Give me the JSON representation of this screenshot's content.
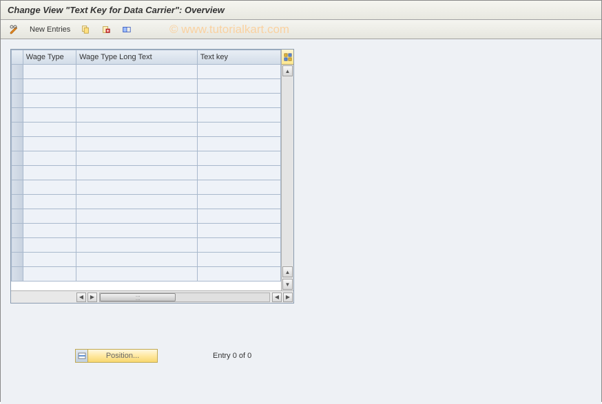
{
  "title": "Change View \"Text Key for Data Carrier\": Overview",
  "toolbar": {
    "new_entries_label": "New Entries"
  },
  "watermark": "© www.tutorialkart.com",
  "table": {
    "columns": {
      "wage_type": "Wage Type",
      "wage_type_long": "Wage Type Long Text",
      "text_key": "Text key"
    },
    "rows": [
      {
        "wage_type": "",
        "wage_type_long": "",
        "text_key": ""
      },
      {
        "wage_type": "",
        "wage_type_long": "",
        "text_key": ""
      },
      {
        "wage_type": "",
        "wage_type_long": "",
        "text_key": ""
      },
      {
        "wage_type": "",
        "wage_type_long": "",
        "text_key": ""
      },
      {
        "wage_type": "",
        "wage_type_long": "",
        "text_key": ""
      },
      {
        "wage_type": "",
        "wage_type_long": "",
        "text_key": ""
      },
      {
        "wage_type": "",
        "wage_type_long": "",
        "text_key": ""
      },
      {
        "wage_type": "",
        "wage_type_long": "",
        "text_key": ""
      },
      {
        "wage_type": "",
        "wage_type_long": "",
        "text_key": ""
      },
      {
        "wage_type": "",
        "wage_type_long": "",
        "text_key": ""
      },
      {
        "wage_type": "",
        "wage_type_long": "",
        "text_key": ""
      },
      {
        "wage_type": "",
        "wage_type_long": "",
        "text_key": ""
      },
      {
        "wage_type": "",
        "wage_type_long": "",
        "text_key": ""
      },
      {
        "wage_type": "",
        "wage_type_long": "",
        "text_key": ""
      },
      {
        "wage_type": "",
        "wage_type_long": "",
        "text_key": ""
      }
    ]
  },
  "footer": {
    "position_label": "Position...",
    "entry_text": "Entry 0 of 0"
  }
}
